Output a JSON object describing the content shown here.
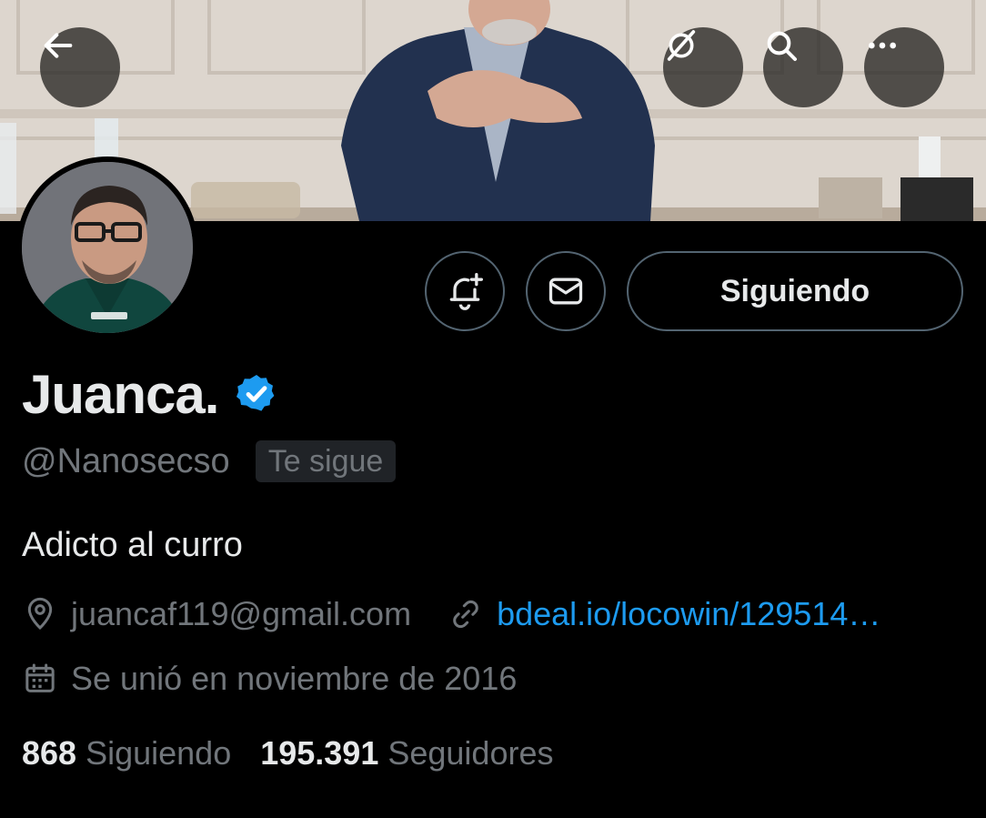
{
  "header": {
    "back_icon": "arrow-left-icon",
    "actions": [
      "mute-icon",
      "search-icon",
      "more-icon"
    ]
  },
  "profile": {
    "name": "Juanca.",
    "verified": true,
    "handle": "@Nanosecso",
    "follows_you": "Te sigue",
    "bio": "Adicto al curro",
    "location": "juancaf119@gmail.com",
    "website": "bdeal.io/locowin/129514…",
    "joined": "Se unió en noviembre de 2016"
  },
  "actions": {
    "notify_icon": "bell-plus-icon",
    "message_icon": "mail-icon",
    "follow_label": "Siguiendo"
  },
  "stats": {
    "following_count": "868",
    "following_label": "Siguiendo",
    "followers_count": "195.391",
    "followers_label": "Seguidores"
  },
  "colors": {
    "accent": "#1d9bf0",
    "secondary_text": "#71767b",
    "primary_text": "#e7e9ea",
    "border": "#536471"
  }
}
